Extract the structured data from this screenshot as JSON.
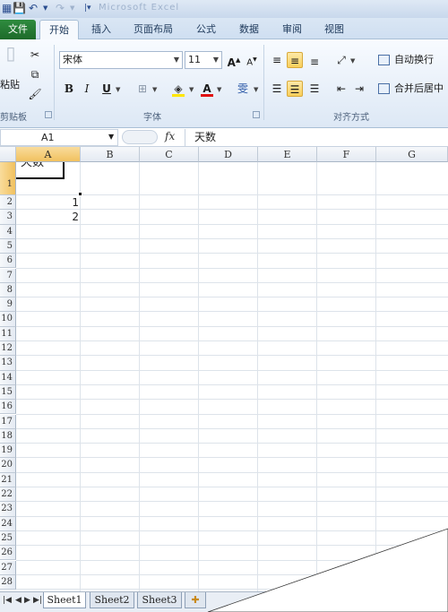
{
  "titlebar": {
    "save_icon": "save-icon",
    "undo_icon": "undo-icon",
    "redo_icon": "redo-icon",
    "customize_icon": "qat-dropdown-icon",
    "title": "Microsoft Excel"
  },
  "tabs": [
    {
      "label": "文件"
    },
    {
      "label": "开始"
    },
    {
      "label": "插入"
    },
    {
      "label": "页面布局"
    },
    {
      "label": "公式"
    },
    {
      "label": "数据"
    },
    {
      "label": "审阅"
    },
    {
      "label": "视图"
    }
  ],
  "ribbon": {
    "clipboard": {
      "paste_label": "粘贴",
      "group_label": "剪贴板"
    },
    "font": {
      "font_name": "宋体",
      "font_size": "11",
      "bold": "B",
      "italic": "I",
      "underline": "U",
      "increase_font": "A",
      "decrease_font": "A",
      "font_color_glyph": "A",
      "fill_glyph": "◈",
      "phonetic_glyph": "雯",
      "group_label": "字体"
    },
    "alignment": {
      "wrap_text": "自动换行",
      "merge_center": "合并后居中",
      "group_label": "对齐方式"
    }
  },
  "formula_bar": {
    "name_box": "A1",
    "fx": "fx",
    "content": "天数"
  },
  "columns": [
    "A",
    "B",
    "C",
    "D",
    "E",
    "F",
    "G"
  ],
  "rows": [
    "1",
    "2",
    "3",
    "4",
    "5",
    "6",
    "7",
    "8",
    "9",
    "10",
    "11",
    "12",
    "13",
    "14",
    "15",
    "16",
    "17",
    "18",
    "19",
    "20",
    "21",
    "22",
    "23",
    "24",
    "25",
    "26",
    "27",
    "28"
  ],
  "cells": {
    "A1": "天数",
    "A2": "1",
    "A3": "2"
  },
  "sheets": [
    "Sheet1",
    "Sheet2",
    "Sheet3"
  ],
  "colors": {
    "accent_file_tab": "#217346",
    "selection_header": "#f1c15f"
  }
}
